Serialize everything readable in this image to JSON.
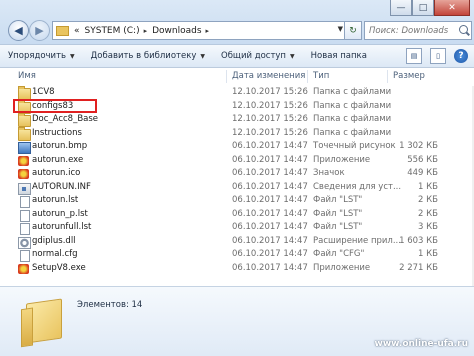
{
  "address": {
    "prefix": "«",
    "segments": [
      "SYSTEM (C:)",
      "Downloads"
    ],
    "separator": "▸"
  },
  "search": {
    "placeholder": "Поиск: Downloads"
  },
  "toolbar": {
    "organize": "Упорядочить",
    "add_to_library": "Добавить в библиотеку",
    "share": "Общий доступ",
    "new_folder": "Новая папка"
  },
  "columns": {
    "name": "Имя",
    "date": "Дата изменения",
    "type": "Тип",
    "size": "Размер"
  },
  "files": [
    {
      "name": "1CV8",
      "date": "12.10.2017 15:26",
      "type": "Папка с файлами",
      "size": "",
      "icon": "folder-icon"
    },
    {
      "name": "configs83",
      "date": "12.10.2017 15:26",
      "type": "Папка с файлами",
      "size": "",
      "icon": "folder-icon"
    },
    {
      "name": "Doc_Acc8_Base",
      "date": "12.10.2017 15:26",
      "type": "Папка с файлами",
      "size": "",
      "icon": "folder-icon"
    },
    {
      "name": "Instructions",
      "date": "12.10.2017 15:26",
      "type": "Папка с файлами",
      "size": "",
      "icon": "folder-icon"
    },
    {
      "name": "autorun.bmp",
      "date": "06.10.2017 14:47",
      "type": "Точечный рисунок",
      "size": "1 302 КБ",
      "icon": "image-icon"
    },
    {
      "name": "autorun.exe",
      "date": "06.10.2017 14:47",
      "type": "Приложение",
      "size": "556 КБ",
      "icon": "app-icon"
    },
    {
      "name": "autorun.ico",
      "date": "06.10.2017 14:47",
      "type": "Значок",
      "size": "449 КБ",
      "icon": "icon-file-icon"
    },
    {
      "name": "AUTORUN.INF",
      "date": "06.10.2017 14:47",
      "type": "Сведения для уст...",
      "size": "1 КБ",
      "icon": "inf-icon"
    },
    {
      "name": "autorun.lst",
      "date": "06.10.2017 14:47",
      "type": "Файл \"LST\"",
      "size": "2 КБ",
      "icon": "file-icon"
    },
    {
      "name": "autorun_p.lst",
      "date": "06.10.2017 14:47",
      "type": "Файл \"LST\"",
      "size": "2 КБ",
      "icon": "file-icon"
    },
    {
      "name": "autorunfull.lst",
      "date": "06.10.2017 14:47",
      "type": "Файл \"LST\"",
      "size": "3 КБ",
      "icon": "file-icon"
    },
    {
      "name": "gdiplus.dll",
      "date": "06.10.2017 14:47",
      "type": "Расширение прил...",
      "size": "1 603 КБ",
      "icon": "dll-icon"
    },
    {
      "name": "normal.cfg",
      "date": "06.10.2017 14:47",
      "type": "Файл \"CFG\"",
      "size": "1 КБ",
      "icon": "file-icon"
    },
    {
      "name": "SetupV8.exe",
      "date": "06.10.2017 14:47",
      "type": "Приложение",
      "size": "2 271 КБ",
      "icon": "app-icon"
    }
  ],
  "details": {
    "items_count": "Элементов: 14"
  },
  "watermark": "www.online-ufa.ru",
  "colors": {
    "highlight": "#e02020",
    "accent": "#1f57a8"
  }
}
